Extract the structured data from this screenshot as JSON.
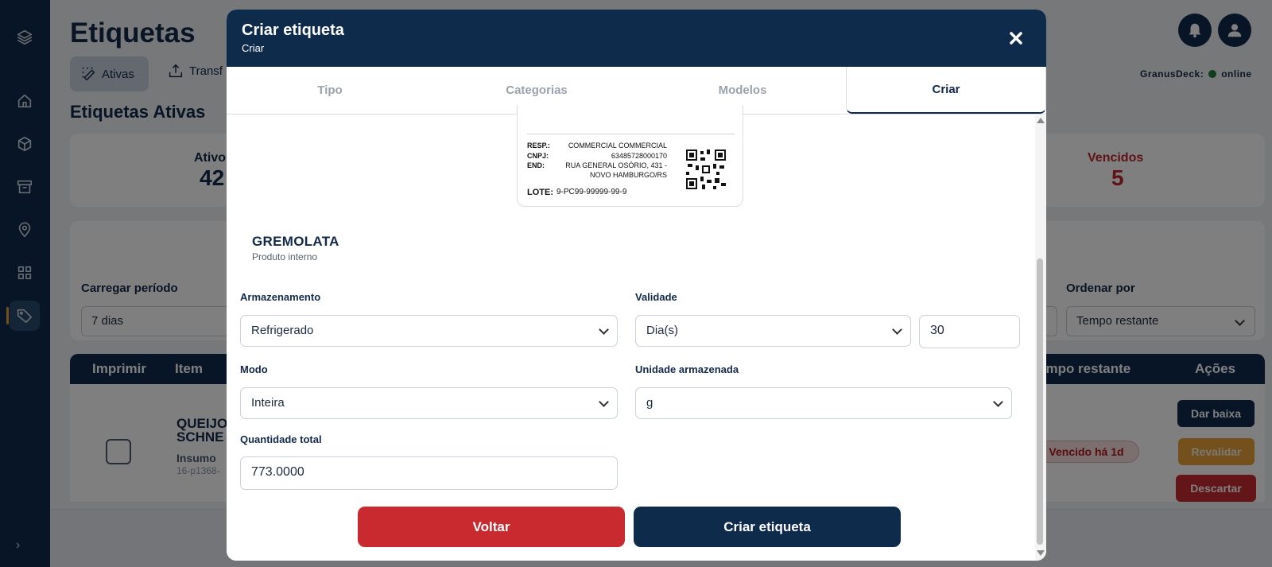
{
  "app": {
    "page_title": "Etiquetas",
    "tabs": [
      {
        "label": "Ativas",
        "icon": "ativas-icon"
      },
      {
        "label": "Transf",
        "icon": "transfer-icon"
      }
    ],
    "section_title": "Etiquetas Ativas",
    "status": {
      "label": "GranusDeck:",
      "value": "online",
      "color": "#1f7a3a"
    },
    "stats": {
      "ativos": {
        "label": "Ativo",
        "value": "42"
      },
      "vencidos": {
        "label": "Vencidos",
        "value": "5"
      }
    },
    "filters": {
      "periodo_label": "Carregar período",
      "periodo_value": "7 dias",
      "ordenar_label": "Ordenar por",
      "ordenar_value": "Tempo restante"
    },
    "table": {
      "headers": {
        "imprimir": "Imprimir",
        "item": "Item",
        "tempo": "empo restante",
        "acoes": "Ações"
      },
      "row": {
        "name": "QUEIJO\nSCHNE",
        "type": "Insumo",
        "code": "16-p1368-",
        "badge": "Vencido há 1d",
        "actions": {
          "baixa": "Dar baixa",
          "revalidar": "Revalidar",
          "descartar": "Descartar"
        }
      }
    },
    "sidebar_icons": [
      "layers-icon",
      "home-icon",
      "box-icon",
      "archive-icon",
      "location-pin-icon",
      "grid-icon",
      "tag-icon"
    ]
  },
  "modal": {
    "title": "Criar etiqueta",
    "subtitle": "Criar",
    "steps": [
      "Tipo",
      "Categorias",
      "Modelos",
      "Criar"
    ],
    "active_step": "Criar",
    "label_preview": {
      "resp_key": "RESP.:",
      "resp_val": "COMMERCIAL COMMERCIAL",
      "cnpj_key": "CNPJ:",
      "cnpj_val": "63485728000170",
      "end_key": "END:",
      "end_val_1": "RUA GENERAL OSÓRIO, 431 -",
      "end_val_2": "NOVO HAMBURGO/RS",
      "lote_key": "LOTE:",
      "lote_val": "9-PC99-99999-99-9"
    },
    "product": {
      "name": "GREMOLATA",
      "type": "Produto interno"
    },
    "form": {
      "armazenamento": {
        "label": "Armazenamento",
        "value": "Refrigerado"
      },
      "validade": {
        "label": "Validade",
        "unit": "Dia(s)",
        "value": "30"
      },
      "modo": {
        "label": "Modo",
        "value": "Inteira"
      },
      "unidade": {
        "label": "Unidade armazenada",
        "value": "g"
      },
      "quantidade": {
        "label": "Quantidade total",
        "value": "773.0000"
      }
    },
    "buttons": {
      "voltar": "Voltar",
      "criar": "Criar etiqueta"
    }
  },
  "colors": {
    "navy": "#0f2b4c",
    "danger": "#c82a30",
    "warning": "#e8a13a"
  }
}
